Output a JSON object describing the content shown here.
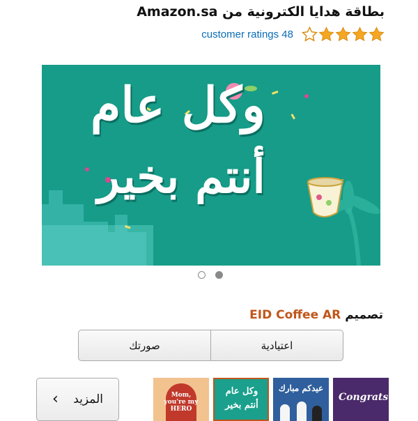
{
  "product": {
    "title": "بطاقة هدايا الكترونية من Amazon.sa",
    "ratings_text": "customer ratings 48",
    "rating": 4.5,
    "rating_max": 5
  },
  "hero": {
    "text_line1": "وكل عام",
    "text_line2": "أنتم بخير",
    "background": "#169c88",
    "carousel_pages": 2,
    "carousel_active": 2
  },
  "design": {
    "label": "تصميم",
    "name": "EID Coffee AR"
  },
  "variants": {
    "options": [
      "اعتيادية",
      "صورتك"
    ]
  },
  "more": {
    "label": "المزيد"
  },
  "thumbnails": [
    {
      "name": "mom-hero",
      "text": "Mom, you're my HERO",
      "bg": "#f2c28f"
    },
    {
      "name": "eid-coffee",
      "text": "وكل عام أنتم بخير",
      "bg": "#1aa08c"
    },
    {
      "name": "eid-mubarak",
      "text": "عيدكم مبارك",
      "bg": "#2f5f9c"
    },
    {
      "name": "congrats",
      "text": "Congrats",
      "bg": "#4a2a6a"
    }
  ]
}
